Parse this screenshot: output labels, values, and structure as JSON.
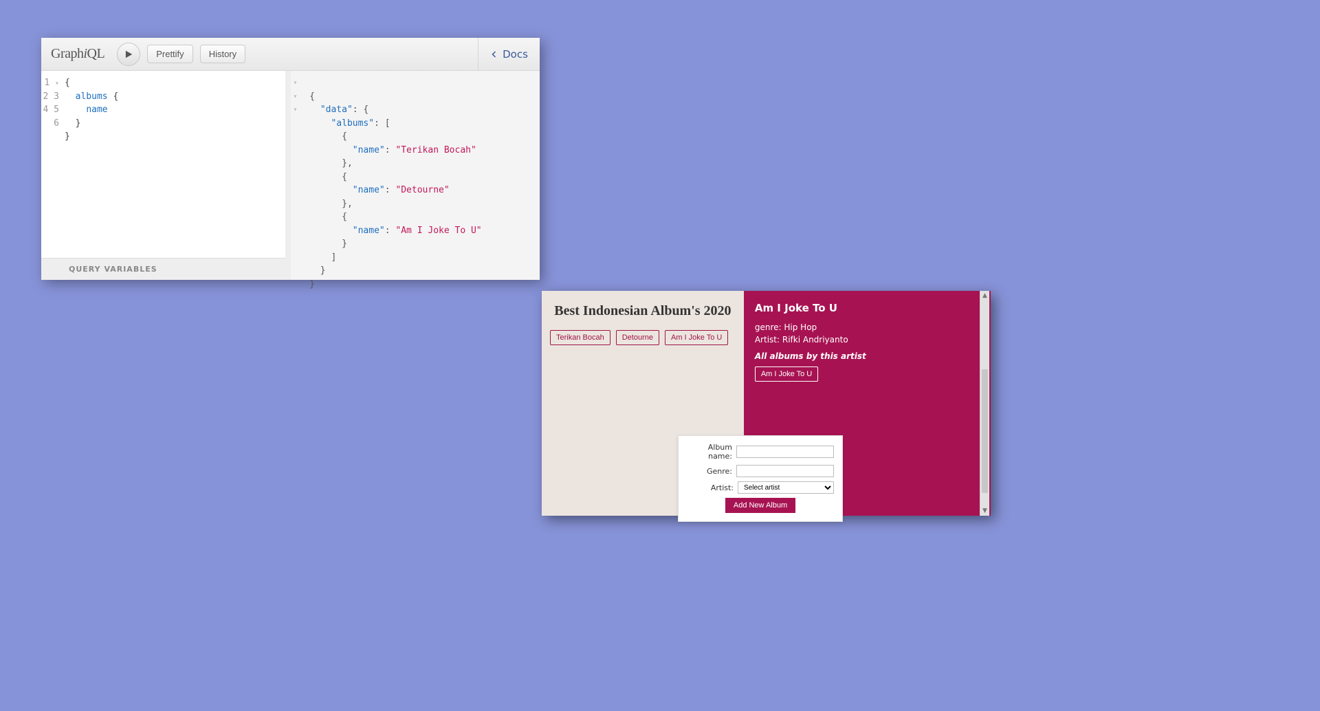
{
  "graphiql": {
    "logo_prefix": "Graph",
    "logo_ital": "i",
    "logo_suffix": "QL",
    "prettify": "Prettify",
    "history": "History",
    "docs": "Docs",
    "query_variables_label": "QUERY VARIABLES",
    "query_lines": [
      "1",
      "2",
      "3",
      "4",
      "5",
      "6"
    ],
    "query": {
      "root_open": "{",
      "albums_kw": "albums",
      "open2": " {",
      "name_field": "name",
      "close2": "  }",
      "close1": "}"
    },
    "result": {
      "data_key": "\"data\"",
      "albums_key": "\"albums\"",
      "name_key": "\"name\"",
      "values": [
        "\"Terikan Bocah\"",
        "\"Detourne\"",
        "\"Am I Joke To U\""
      ]
    }
  },
  "app": {
    "title": "Best Indonesian Album's 2020",
    "albums": [
      "Terikan Bocah",
      "Detourne",
      "Am I Joke To U"
    ],
    "detail": {
      "title": "Am I Joke To U",
      "genre_label": "genre:",
      "genre": "Hip Hop",
      "artist_label": "Artist:",
      "artist": "Rifki Andriyanto",
      "all_by": "All albums by this artist",
      "artist_albums": [
        "Am I Joke To U"
      ]
    },
    "form": {
      "album_label": "Album name:",
      "genre_label": "Genre:",
      "artist_label": "Artist:",
      "select_placeholder": "Select artist",
      "submit": "Add New Album"
    }
  }
}
